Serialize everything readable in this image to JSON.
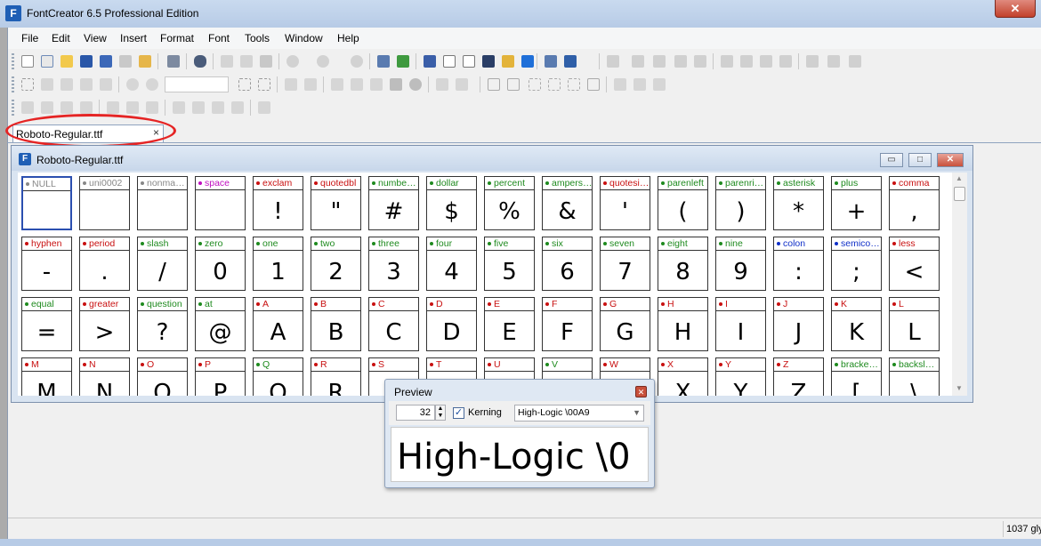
{
  "window": {
    "title": "FontCreator 6.5 Professional Edition",
    "app_icon": "F",
    "close_glyph": "✕"
  },
  "menu": [
    "File",
    "Edit",
    "View",
    "Insert",
    "Format",
    "Font",
    "Tools",
    "Window",
    "Help"
  ],
  "doc_tab": {
    "label": "Roboto-Regular.ttf",
    "close": "×"
  },
  "child_window": {
    "title": "Roboto-Regular.ttf",
    "min": "▭",
    "max": "□",
    "close": "✕"
  },
  "colors": {
    "green": "#1e8a1e",
    "red": "#c81010",
    "blue": "#1030c8",
    "magenta": "#c010c0",
    "gray": "#888888"
  },
  "glyph_rows": [
    [
      {
        "name": "NULL",
        "glyph": "",
        "color": "gray",
        "selected": true
      },
      {
        "name": "uni0002",
        "glyph": "",
        "color": "gray"
      },
      {
        "name": "nonma…",
        "glyph": "",
        "color": "gray"
      },
      {
        "name": "space",
        "glyph": "",
        "color": "magenta"
      },
      {
        "name": "exclam",
        "glyph": "!",
        "color": "red"
      },
      {
        "name": "quotedbl",
        "glyph": "\"",
        "color": "red"
      },
      {
        "name": "numbe…",
        "glyph": "#",
        "color": "green"
      },
      {
        "name": "dollar",
        "glyph": "$",
        "color": "green"
      },
      {
        "name": "percent",
        "glyph": "%",
        "color": "green"
      },
      {
        "name": "ampers…",
        "glyph": "&",
        "color": "green"
      },
      {
        "name": "quotesi…",
        "glyph": "'",
        "color": "red"
      },
      {
        "name": "parenleft",
        "glyph": "(",
        "color": "green"
      },
      {
        "name": "parenri…",
        "glyph": ")",
        "color": "green"
      },
      {
        "name": "asterisk",
        "glyph": "*",
        "color": "green"
      },
      {
        "name": "plus",
        "glyph": "+",
        "color": "green"
      },
      {
        "name": "comma",
        "glyph": ",",
        "color": "red"
      }
    ],
    [
      {
        "name": "hyphen",
        "glyph": "-",
        "color": "red"
      },
      {
        "name": "period",
        "glyph": ".",
        "color": "red"
      },
      {
        "name": "slash",
        "glyph": "/",
        "color": "green"
      },
      {
        "name": "zero",
        "glyph": "0",
        "color": "green"
      },
      {
        "name": "one",
        "glyph": "1",
        "color": "green"
      },
      {
        "name": "two",
        "glyph": "2",
        "color": "green"
      },
      {
        "name": "three",
        "glyph": "3",
        "color": "green"
      },
      {
        "name": "four",
        "glyph": "4",
        "color": "green"
      },
      {
        "name": "five",
        "glyph": "5",
        "color": "green"
      },
      {
        "name": "six",
        "glyph": "6",
        "color": "green"
      },
      {
        "name": "seven",
        "glyph": "7",
        "color": "green"
      },
      {
        "name": "eight",
        "glyph": "8",
        "color": "green"
      },
      {
        "name": "nine",
        "glyph": "9",
        "color": "green"
      },
      {
        "name": "colon",
        "glyph": ":",
        "color": "blue"
      },
      {
        "name": "semico…",
        "glyph": ";",
        "color": "blue"
      },
      {
        "name": "less",
        "glyph": "<",
        "color": "red"
      }
    ],
    [
      {
        "name": "equal",
        "glyph": "=",
        "color": "green"
      },
      {
        "name": "greater",
        "glyph": ">",
        "color": "red"
      },
      {
        "name": "question",
        "glyph": "?",
        "color": "green"
      },
      {
        "name": "at",
        "glyph": "@",
        "color": "green"
      },
      {
        "name": "A",
        "glyph": "A",
        "color": "red"
      },
      {
        "name": "B",
        "glyph": "B",
        "color": "red"
      },
      {
        "name": "C",
        "glyph": "C",
        "color": "red"
      },
      {
        "name": "D",
        "glyph": "D",
        "color": "red"
      },
      {
        "name": "E",
        "glyph": "E",
        "color": "red"
      },
      {
        "name": "F",
        "glyph": "F",
        "color": "red"
      },
      {
        "name": "G",
        "glyph": "G",
        "color": "red"
      },
      {
        "name": "H",
        "glyph": "H",
        "color": "red"
      },
      {
        "name": "I",
        "glyph": "I",
        "color": "red"
      },
      {
        "name": "J",
        "glyph": "J",
        "color": "red"
      },
      {
        "name": "K",
        "glyph": "K",
        "color": "red"
      },
      {
        "name": "L",
        "glyph": "L",
        "color": "red"
      }
    ],
    [
      {
        "name": "M",
        "glyph": "M",
        "color": "red"
      },
      {
        "name": "N",
        "glyph": "N",
        "color": "red"
      },
      {
        "name": "O",
        "glyph": "O",
        "color": "red"
      },
      {
        "name": "P",
        "glyph": "P",
        "color": "red"
      },
      {
        "name": "Q",
        "glyph": "Q",
        "color": "green"
      },
      {
        "name": "R",
        "glyph": "R",
        "color": "red"
      },
      {
        "name": "S",
        "glyph": "S",
        "color": "red"
      },
      {
        "name": "T",
        "glyph": "T",
        "color": "red"
      },
      {
        "name": "U",
        "glyph": "U",
        "color": "red"
      },
      {
        "name": "V",
        "glyph": "V",
        "color": "green"
      },
      {
        "name": "W",
        "glyph": "W",
        "color": "red"
      },
      {
        "name": "X",
        "glyph": "X",
        "color": "red"
      },
      {
        "name": "Y",
        "glyph": "Y",
        "color": "red"
      },
      {
        "name": "Z",
        "glyph": "Z",
        "color": "red"
      },
      {
        "name": "bracke…",
        "glyph": "[",
        "color": "green"
      },
      {
        "name": "backsl…",
        "glyph": "\\",
        "color": "green"
      }
    ]
  ],
  "preview": {
    "title": "Preview",
    "close": "✕",
    "size": "32",
    "spin_up": "▲",
    "spin_down": "▼",
    "kerning_label": "Kerning",
    "kerning_check": "✓",
    "text_value": "High-Logic \\00A9",
    "combo_arrow": "▼",
    "rendered": "High-Logic \\0"
  },
  "status": {
    "glyph_count": "1037 gly"
  },
  "scroll": {
    "up": "▲",
    "down": "▼"
  }
}
